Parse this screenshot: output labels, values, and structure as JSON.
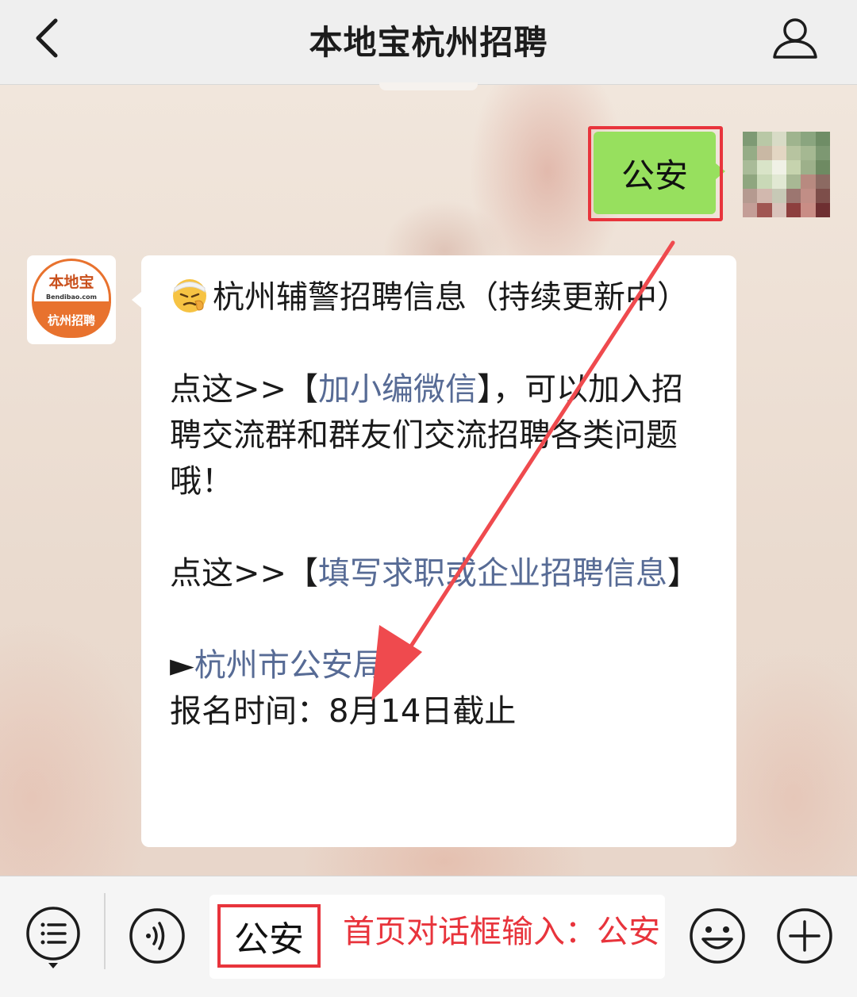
{
  "nav": {
    "title": "本地宝杭州招聘",
    "back_icon": "chevron-left-icon",
    "profile_icon": "user-icon"
  },
  "sent_message": {
    "text": "公安"
  },
  "official_account": {
    "logo_name": "本地宝",
    "logo_domain": "Bendibao.com",
    "logo_sub": "杭州招聘"
  },
  "reply": {
    "title_emoji": "thinking-face-icon",
    "title": "杭州辅警招聘信息（持续更新中）",
    "p1_prefix": "点这>>【",
    "p1_link": "加小编微信",
    "p1_suffix": "】，可以加入招聘交流群和群友们交流招聘各类问题哦！",
    "p2_prefix": "点这>>【",
    "p2_link": "填写求职或企业招聘信息",
    "p2_suffix": "】",
    "item_marker": "►",
    "item_link": "杭州市公安局",
    "deadline": "报名时间：8月14日截止"
  },
  "input_bar": {
    "menu_icon": "menu-list-icon",
    "voice_icon": "voice-icon",
    "input_value": "公安",
    "hint": "首页对话框输入：公安",
    "emoji_icon": "smiley-icon",
    "plus_icon": "plus-icon"
  },
  "colors": {
    "highlight": "#e8343c",
    "sent_bubble": "#97e05e",
    "link": "#576b95",
    "brand_orange": "#e8722e"
  }
}
